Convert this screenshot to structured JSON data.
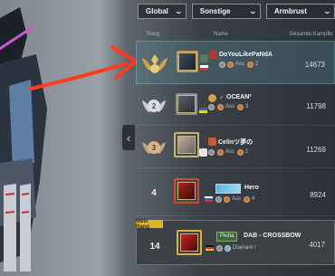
{
  "filters": {
    "region": "Global",
    "category": "Sonstige",
    "weapon": "Armbrust"
  },
  "headers": {
    "rank": "Rang",
    "name": "Name",
    "score": "Gesamte Kampfkr"
  },
  "rows": [
    {
      "rank": "1",
      "name": "DoYouLikePaNdA",
      "tier": "Ass",
      "tier_level": "2",
      "score": "14673"
    },
    {
      "rank": "2",
      "name": "OCEAN²",
      "tier": "Ass",
      "tier_level": "3",
      "score": "11798"
    },
    {
      "rank": "3",
      "name": "Celinツ夢の",
      "tier": "Ass",
      "tier_level": "2",
      "score": "11269"
    },
    {
      "rank": "4",
      "name": "Hero",
      "tier": "Ass",
      "tier_level": "4",
      "score": "8924"
    }
  ],
  "my_rank": {
    "label": "Mein Rang",
    "rank": "14",
    "tag": "Pleba",
    "name": "DAB - CROSSBOW",
    "tier": "Diamant I",
    "score": "4017"
  },
  "colors": {
    "accent": "#e0b321",
    "highlight": "#5a96a0",
    "arrow": "#ff3b1f"
  },
  "icons": {
    "dropdown": "chevron-down-icon",
    "collapse": "chevron-left-icon"
  }
}
